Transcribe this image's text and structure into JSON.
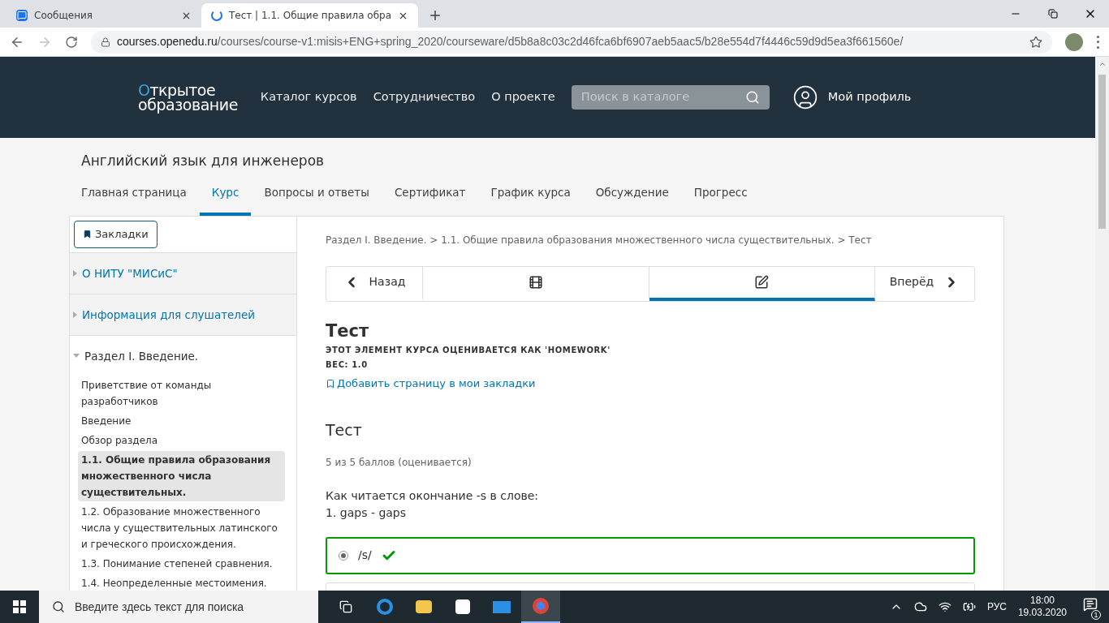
{
  "browser": {
    "tabs": [
      {
        "title": "Сообщения",
        "selected": false,
        "kind": "chat"
      },
      {
        "title": "Тест | 1.1. Общие правила обра",
        "selected": true,
        "kind": "loading"
      }
    ],
    "url_host": "courses.openedu.ru",
    "url_path": "/courses/course-v1:misis+ENG+spring_2020/courseware/d5b8a8c03c2d46fca6bf6907aeb5aac5/b28e554d7f4446c59d9d5ea3f661560e/"
  },
  "site_header": {
    "logo_lines": [
      "Открытое",
      "образование"
    ],
    "nav": [
      "Каталог курсов",
      "Сотрудничество",
      "О проекте"
    ],
    "search": {
      "placeholder": "Поиск в каталоге"
    },
    "profile": "Мой профиль"
  },
  "course": {
    "title": "Английский язык для инженеров",
    "tabs": [
      {
        "label": "Главная страница",
        "selected": false
      },
      {
        "label": "Курс",
        "selected": true
      },
      {
        "label": "Вопросы и ответы",
        "selected": false
      },
      {
        "label": "Сертификат",
        "selected": false
      },
      {
        "label": "График курса",
        "selected": false
      },
      {
        "label": "Обсуждение",
        "selected": false
      },
      {
        "label": "Прогресс",
        "selected": false
      }
    ]
  },
  "sidebar": {
    "bookmarks_button": "Закладки",
    "sections": [
      {
        "title": "О НИТУ \"МИСиС\"",
        "expanded": false
      },
      {
        "title": "Информация для слушателей",
        "expanded": false
      },
      {
        "title": "Раздел I. Введение.",
        "expanded": true,
        "children": [
          {
            "label": "Приветствие от команды разработчиков",
            "selected": false
          },
          {
            "label": "Введение",
            "selected": false
          },
          {
            "label": "Обзор раздела",
            "selected": false
          },
          {
            "label": "1.1. Общие правила образования множественного числа существительных.",
            "selected": true
          },
          {
            "label": "1.2. Образование множественного числа у существительных латинского и греческого происхождения.",
            "selected": false
          },
          {
            "label": "1.3. Понимание степеней сравнения.",
            "selected": false
          },
          {
            "label": "1.4. Неопределенные местоимения.",
            "selected": false
          }
        ]
      }
    ]
  },
  "main": {
    "breadcrumb": "Раздел I. Введение. > 1.1. Общие правила образования множественного числа существительных. > Тест",
    "sequence": [
      {
        "kind": "prev",
        "label": "Назад",
        "selected": false
      },
      {
        "kind": "video",
        "selected": false
      },
      {
        "kind": "problem",
        "selected": true
      },
      {
        "kind": "next",
        "label": "Вперёд",
        "selected": false
      }
    ],
    "unit_title": "Тест",
    "grading_note": "ЭТОТ ЭЛЕМЕНТ КУРСА ОЦЕНИВАЕТСЯ КАК 'HOMEWORK'",
    "weight": "ВЕС: 1.0",
    "bookmark_link": "Добавить страницу в мои закладки",
    "problem": {
      "title": "Тест",
      "score": "5 из 5 баллов (оценивается)",
      "question_lines": [
        "Как читается окончание -s в слове:",
        "1. gaps - gaps"
      ],
      "options": [
        {
          "label": "/s/",
          "selected": true,
          "correct": true
        }
      ]
    }
  },
  "taskbar": {
    "search_placeholder": "Введите здесь текст для поиска",
    "language": "РУС",
    "time": "18:00",
    "date": "19.03.2020",
    "notifications": "1"
  }
}
